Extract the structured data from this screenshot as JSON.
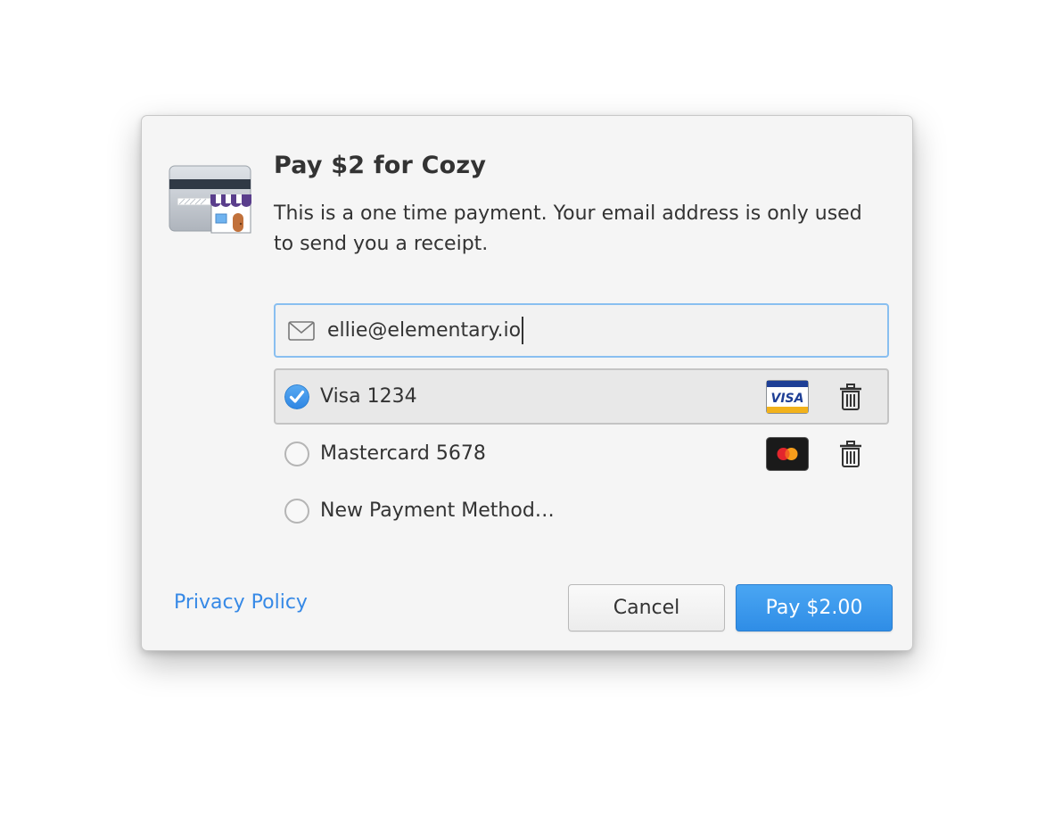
{
  "dialog": {
    "title": "Pay $2 for Cozy",
    "description": "This is a one time payment. Your email address is only used to send you a receipt.",
    "app_icon": "store-card-icon"
  },
  "email": {
    "icon": "mail-icon",
    "value": "ellie@elementary.io",
    "focused": true
  },
  "payment_methods": [
    {
      "label": "Visa 1234",
      "selected": true,
      "card_icon": "visa-logo-icon",
      "delete_icon": "trash-icon"
    },
    {
      "label": "Mastercard 5678",
      "selected": false,
      "card_icon": "mastercard-logo-icon",
      "delete_icon": "trash-icon"
    },
    {
      "label": "New Payment Method…",
      "selected": false
    }
  ],
  "footer": {
    "privacy_link": "Privacy Policy",
    "cancel_label": "Cancel",
    "pay_label": "Pay $2.00"
  },
  "colors": {
    "accent": "#3689e6",
    "pay_button": "#3a97ec",
    "focus_border": "#89bff0",
    "dialog_bg": "#f5f5f5"
  }
}
